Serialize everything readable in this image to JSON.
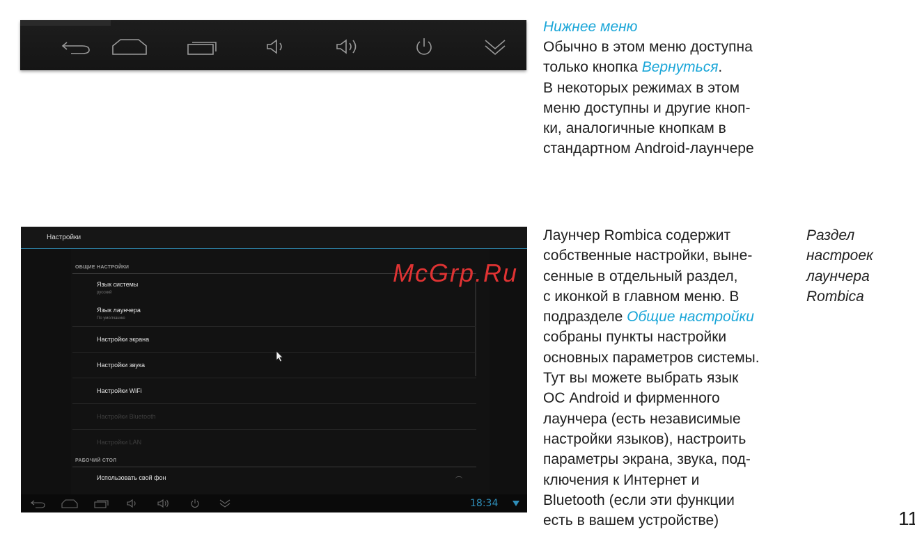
{
  "nav_caption": "Нижнее меню",
  "p1": {
    "l1": "Обычно в этом меню доступна",
    "l2a": "только кнопка ",
    "l2b": "Вернуться",
    "l2c": ".",
    "l3": "В некоторых режимах в этом",
    "l4": "меню доступны и другие кноп-",
    "l5": "ки, аналогичные кнопкам в",
    "l6": "стандартном Android-лаунчере"
  },
  "p2": {
    "l1": "Лаунчер Rombica содержит",
    "l2": "собственные настройки, выне-",
    "l3": "сенные в отдельный раздел,",
    "l4": "с иконкой в главном меню. В",
    "l5a": "подразделе ",
    "l5b": "Общие настройки",
    "l6": "собраны пункты настройки",
    "l7": "основных параметров системы.",
    "l8": "Тут вы можете выбрать язык",
    "l9": "ОС Android и фирменного",
    "l10": "лаунчера (есть независимые",
    "l11": "настройки языков), настроить",
    "l12": "параметры экрана, звука, под-",
    "l13": "ключения к Интернет и",
    "l14": "Bluetooth (если эти функции",
    "l15": "есть в вашем устройстве)"
  },
  "side_note": [
    "Раздел",
    "настроек",
    "лаунчера",
    "Rombica"
  ],
  "page_number": "11",
  "watermark": "McGrp.Ru",
  "nav_icons": [
    "back-icon",
    "home-icon",
    "recent-apps-icon",
    "volume-down-icon",
    "volume-up-icon",
    "power-icon",
    "collapse-icon"
  ],
  "settings": {
    "title": "Настройки",
    "section_general": "ОБЩИЕ НАСТРОЙКИ",
    "system_language": "Язык системы",
    "system_language_value": "русский",
    "launcher_language": "Язык лаунчера",
    "launcher_language_value": "По умолчанию",
    "screen": "Настройки экрана",
    "sound": "Настройки звука",
    "wifi": "Настройки WiFi",
    "bluetooth": "Настройки Bluetooth",
    "lan": "Настройки LAN",
    "section_desktop": "РАБОЧИЙ СТОЛ",
    "custom_wallpaper": "Использовать свой фон",
    "clock": "18:34"
  },
  "colors": {
    "accent": "#1aa6d8",
    "clock": "#2f8fba",
    "watermark": "#e03333"
  }
}
